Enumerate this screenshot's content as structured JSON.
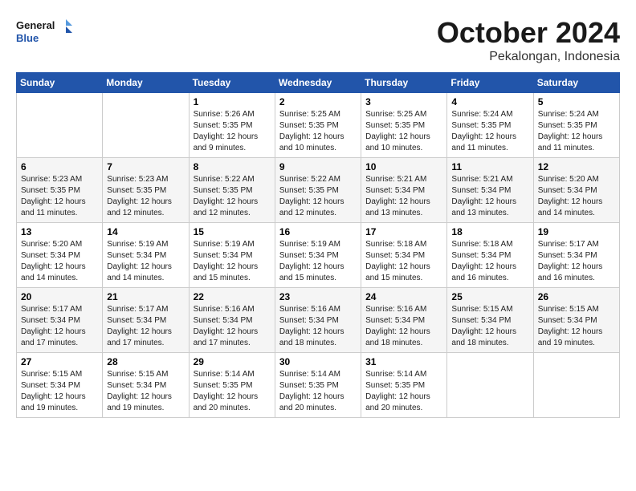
{
  "logo": {
    "line1": "General",
    "line2": "Blue"
  },
  "header": {
    "month": "October 2024",
    "location": "Pekalongan, Indonesia"
  },
  "weekdays": [
    "Sunday",
    "Monday",
    "Tuesday",
    "Wednesday",
    "Thursday",
    "Friday",
    "Saturday"
  ],
  "weeks": [
    [
      {
        "day": null
      },
      {
        "day": null
      },
      {
        "day": "1",
        "sunrise": "5:26 AM",
        "sunset": "5:35 PM",
        "daylight": "12 hours and 9 minutes."
      },
      {
        "day": "2",
        "sunrise": "5:25 AM",
        "sunset": "5:35 PM",
        "daylight": "12 hours and 10 minutes."
      },
      {
        "day": "3",
        "sunrise": "5:25 AM",
        "sunset": "5:35 PM",
        "daylight": "12 hours and 10 minutes."
      },
      {
        "day": "4",
        "sunrise": "5:24 AM",
        "sunset": "5:35 PM",
        "daylight": "12 hours and 11 minutes."
      },
      {
        "day": "5",
        "sunrise": "5:24 AM",
        "sunset": "5:35 PM",
        "daylight": "12 hours and 11 minutes."
      }
    ],
    [
      {
        "day": "6",
        "sunrise": "5:23 AM",
        "sunset": "5:35 PM",
        "daylight": "12 hours and 11 minutes."
      },
      {
        "day": "7",
        "sunrise": "5:23 AM",
        "sunset": "5:35 PM",
        "daylight": "12 hours and 12 minutes."
      },
      {
        "day": "8",
        "sunrise": "5:22 AM",
        "sunset": "5:35 PM",
        "daylight": "12 hours and 12 minutes."
      },
      {
        "day": "9",
        "sunrise": "5:22 AM",
        "sunset": "5:35 PM",
        "daylight": "12 hours and 12 minutes."
      },
      {
        "day": "10",
        "sunrise": "5:21 AM",
        "sunset": "5:34 PM",
        "daylight": "12 hours and 13 minutes."
      },
      {
        "day": "11",
        "sunrise": "5:21 AM",
        "sunset": "5:34 PM",
        "daylight": "12 hours and 13 minutes."
      },
      {
        "day": "12",
        "sunrise": "5:20 AM",
        "sunset": "5:34 PM",
        "daylight": "12 hours and 14 minutes."
      }
    ],
    [
      {
        "day": "13",
        "sunrise": "5:20 AM",
        "sunset": "5:34 PM",
        "daylight": "12 hours and 14 minutes."
      },
      {
        "day": "14",
        "sunrise": "5:19 AM",
        "sunset": "5:34 PM",
        "daylight": "12 hours and 14 minutes."
      },
      {
        "day": "15",
        "sunrise": "5:19 AM",
        "sunset": "5:34 PM",
        "daylight": "12 hours and 15 minutes."
      },
      {
        "day": "16",
        "sunrise": "5:19 AM",
        "sunset": "5:34 PM",
        "daylight": "12 hours and 15 minutes."
      },
      {
        "day": "17",
        "sunrise": "5:18 AM",
        "sunset": "5:34 PM",
        "daylight": "12 hours and 15 minutes."
      },
      {
        "day": "18",
        "sunrise": "5:18 AM",
        "sunset": "5:34 PM",
        "daylight": "12 hours and 16 minutes."
      },
      {
        "day": "19",
        "sunrise": "5:17 AM",
        "sunset": "5:34 PM",
        "daylight": "12 hours and 16 minutes."
      }
    ],
    [
      {
        "day": "20",
        "sunrise": "5:17 AM",
        "sunset": "5:34 PM",
        "daylight": "12 hours and 17 minutes."
      },
      {
        "day": "21",
        "sunrise": "5:17 AM",
        "sunset": "5:34 PM",
        "daylight": "12 hours and 17 minutes."
      },
      {
        "day": "22",
        "sunrise": "5:16 AM",
        "sunset": "5:34 PM",
        "daylight": "12 hours and 17 minutes."
      },
      {
        "day": "23",
        "sunrise": "5:16 AM",
        "sunset": "5:34 PM",
        "daylight": "12 hours and 18 minutes."
      },
      {
        "day": "24",
        "sunrise": "5:16 AM",
        "sunset": "5:34 PM",
        "daylight": "12 hours and 18 minutes."
      },
      {
        "day": "25",
        "sunrise": "5:15 AM",
        "sunset": "5:34 PM",
        "daylight": "12 hours and 18 minutes."
      },
      {
        "day": "26",
        "sunrise": "5:15 AM",
        "sunset": "5:34 PM",
        "daylight": "12 hours and 19 minutes."
      }
    ],
    [
      {
        "day": "27",
        "sunrise": "5:15 AM",
        "sunset": "5:34 PM",
        "daylight": "12 hours and 19 minutes."
      },
      {
        "day": "28",
        "sunrise": "5:15 AM",
        "sunset": "5:34 PM",
        "daylight": "12 hours and 19 minutes."
      },
      {
        "day": "29",
        "sunrise": "5:14 AM",
        "sunset": "5:35 PM",
        "daylight": "12 hours and 20 minutes."
      },
      {
        "day": "30",
        "sunrise": "5:14 AM",
        "sunset": "5:35 PM",
        "daylight": "12 hours and 20 minutes."
      },
      {
        "day": "31",
        "sunrise": "5:14 AM",
        "sunset": "5:35 PM",
        "daylight": "12 hours and 20 minutes."
      },
      {
        "day": null
      },
      {
        "day": null
      }
    ]
  ]
}
